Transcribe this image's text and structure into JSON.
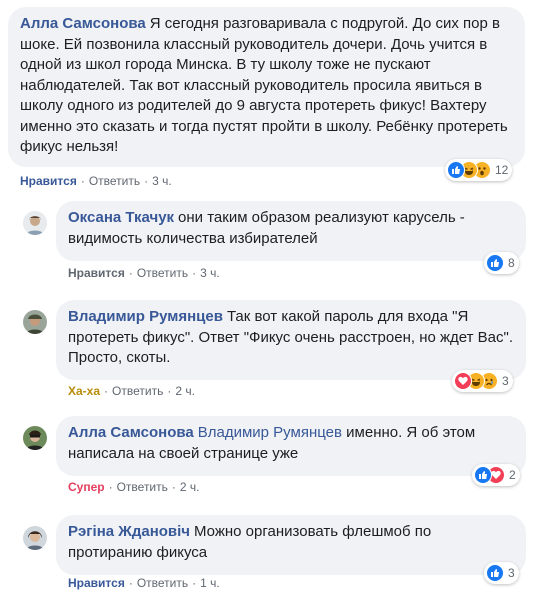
{
  "comments": [
    {
      "author": "Алла Самсонова",
      "text": "Я сегодня разговаривала с подругой. До сих пор в шоке. Ей позвонила классный руководитель дочери. Дочь учится в одной из школ города Минска. В ту школу тоже не пускают наблюдателей. Так вот классный руководитель просила явиться в школу одного из родителей до 9 августа протереть фикус! Вахтеру именно это сказать и тогда пустят пройти в школу. Ребёнку протереть фикус нельзя!",
      "reaction_label": "Нравится",
      "reply_label": "Ответить",
      "time": "3 ч.",
      "reaction_count": "12",
      "reaction_icons": [
        "like-icon",
        "haha-icon",
        "wow-icon"
      ]
    },
    {
      "author": "Оксана Ткачук",
      "text": "они таким образом реализуют карусель - видимость количества избирателей",
      "reaction_label": "Нравится",
      "reply_label": "Ответить",
      "time": "3 ч.",
      "reaction_count": "8",
      "reaction_icons": [
        "like-icon"
      ]
    },
    {
      "author": "Владимир Румянцев",
      "text": "Так вот какой пароль для входа \"Я протереть фикус\". Ответ \"Фикус очень расстроен, но ждет Вас\". Просто, скоты.",
      "reaction_label": "Ха-ха",
      "reply_label": "Ответить",
      "time": "2 ч.",
      "reaction_count": "3",
      "reaction_icons": [
        "love-icon",
        "haha-icon",
        "sad-icon"
      ]
    },
    {
      "author": "Алла Самсонова",
      "mention": "Владимир Румянцев",
      "text": "именно. Я об этом написала на своей странице уже",
      "reaction_label": "Супер",
      "reply_label": "Ответить",
      "time": "2 ч.",
      "reaction_count": "2",
      "reaction_icons": [
        "like-icon",
        "love-icon"
      ]
    },
    {
      "author": "Рэгіна Ждановіч",
      "text": "Можно организовать флешмоб по протиранию фикуса",
      "reaction_label": "Нравится",
      "reply_label": "Ответить",
      "time": "1 ч.",
      "reaction_count": "3",
      "reaction_icons": [
        "like-icon"
      ]
    }
  ],
  "separator": "·",
  "colors": {
    "bubble": "#f0f2f5",
    "author": "#385898",
    "like": "#1877f2",
    "love": "#f33e58",
    "haha": "#f7b125",
    "action_text": "#606770"
  }
}
